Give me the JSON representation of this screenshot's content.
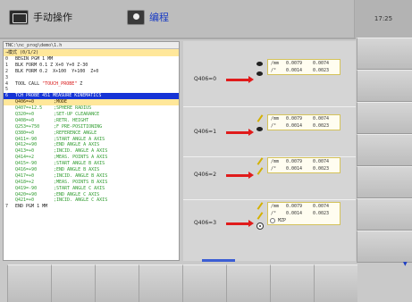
{
  "header": {
    "mode_manual": "手动操作",
    "mode_edit": "编程",
    "clock": "17:25",
    "accent": "#1a3cc4"
  },
  "editor": {
    "path": "TNC:\\nc_prog\\demo\\1.h",
    "subheader": "→模式 (0/1/2)",
    "lines": [
      {
        "num": "0",
        "text": "BEGIN PGM 1 MM"
      },
      {
        "num": "1",
        "text": "BLK FORM 0.1 Z X+0 Y+0 Z-30"
      },
      {
        "num": "2",
        "text": "BLK FORM 0.2  X+100  Y+100  Z+0"
      },
      {
        "num": "3",
        "text": ""
      },
      {
        "num": "4",
        "text": "TOOL CALL ",
        "red": "\"TOUCH_PROBE\"",
        "after": " Z"
      },
      {
        "num": "5",
        "text": ""
      },
      {
        "num": "6",
        "text": "TCH PROBE 451 MEASURE KINEMATICS"
      },
      {
        "num": "",
        "text": "Q406=+0",
        "comment": ";MODE"
      },
      {
        "num": "",
        "text": "Q407=+12.5",
        "comment": ";SPHERE RADIUS"
      },
      {
        "num": "",
        "text": "Q320=+0",
        "comment": ";SET-UP CLEARANCE"
      },
      {
        "num": "",
        "text": "Q408=+0",
        "comment": ";RETR. HEIGHT"
      },
      {
        "num": "",
        "text": "Q253=+750",
        "comment": ";F PRE-POSITIONING"
      },
      {
        "num": "",
        "text": "Q380=+0",
        "comment": ";REFERENCE ANGLE"
      },
      {
        "num": "",
        "text": "Q411=-90",
        "comment": ";START ANGLE A AXIS"
      },
      {
        "num": "",
        "text": "Q412=+90",
        "comment": ";END ANGLE A AXIS"
      },
      {
        "num": "",
        "text": "Q413=+0",
        "comment": ";INCID. ANGLE A AXIS"
      },
      {
        "num": "",
        "text": "Q414=+2",
        "comment": ";MEAS. POINTS A AXIS"
      },
      {
        "num": "",
        "text": "Q415=-90",
        "comment": ";START ANGLE B AXIS"
      },
      {
        "num": "",
        "text": "Q416=+90",
        "comment": ";END ANGLE B AXIS"
      },
      {
        "num": "",
        "text": "Q417=+0",
        "comment": ";INCID. ANGLE B AXIS"
      },
      {
        "num": "",
        "text": "Q418=+2",
        "comment": ";MEAS. POINTS B AXIS"
      },
      {
        "num": "",
        "text": "Q419=-90",
        "comment": ";START ANGLE C AXIS"
      },
      {
        "num": "",
        "text": "Q420=+90",
        "comment": ";END ANGLE C AXIS"
      },
      {
        "num": "",
        "text": "Q421=+0",
        "comment": ";INCID. ANGLE C AXIS"
      },
      {
        "num": "7",
        "text": "END PGM 1 MM"
      }
    ]
  },
  "graphic": {
    "rows": [
      {
        "label": "Q406=0",
        "icons": [
          "eye-icon",
          "eye-icon"
        ],
        "r1": [
          "/mm",
          "0.0079",
          "0.0074"
        ],
        "r2": [
          "/°",
          "0.0014",
          "0.0023"
        ],
        "flag": ""
      },
      {
        "label": "Q406=1",
        "icons": [
          "pen-icon",
          "eye-icon"
        ],
        "r1": [
          "/mm",
          "0.0079",
          "0.0074"
        ],
        "r2": [
          "/°",
          "0.0014",
          "0.0023"
        ],
        "flag": ""
      },
      {
        "label": "Q406=2",
        "icons": [
          "pen-icon",
          "pen-icon"
        ],
        "r1": [
          "/mm",
          "0.0079",
          "0.0074"
        ],
        "r2": [
          "/°",
          "0.0014",
          "0.0023"
        ],
        "flag": ""
      },
      {
        "label": "Q406=3",
        "icons": [
          "pen-icon",
          "pen-icon",
          "gear-icon"
        ],
        "r1": [
          "/mm",
          "0.0079",
          "0.0074"
        ],
        "r2": [
          "/°",
          "0.0014",
          "0.0023"
        ],
        "flag": "MZP"
      }
    ]
  },
  "softkeys_right": [
    "",
    "",
    "",
    "",
    "",
    "",
    ""
  ],
  "softkeys_bottom": [
    "",
    "",
    "",
    "",
    "",
    "",
    "",
    ""
  ]
}
